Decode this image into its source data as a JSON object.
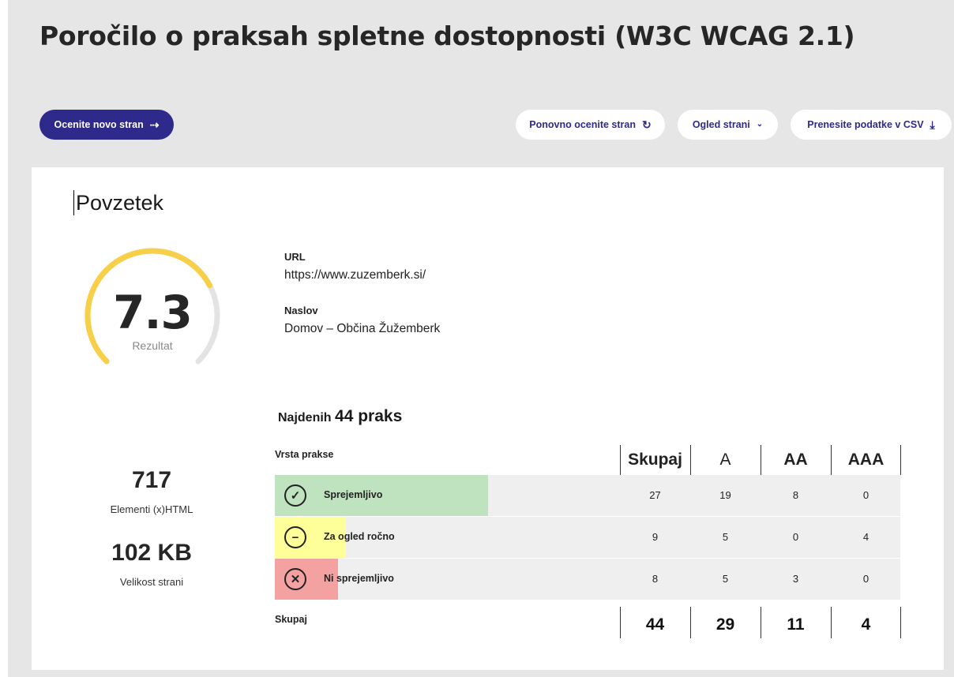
{
  "page": {
    "title": "Poročilo o praksah spletne dostopnosti (W3C WCAG 2.1)"
  },
  "toolbar": {
    "new_page_label": "Ocenite novo stran",
    "new_page_icon": "arrow-right-icon",
    "reassess_label": "Ponovno ocenite stran",
    "reassess_icon": "refresh-icon",
    "view_label": "Ogled strani",
    "view_icon": "chevron-down-icon",
    "csv_label": "Prenesite podatke v CSV",
    "csv_icon": "download-icon"
  },
  "summary": {
    "title": "Povzetek",
    "score": "7.3",
    "score_fraction": 0.73,
    "score_label": "Rezultat",
    "url_label": "URL",
    "url_value": "https://www.zuzemberk.si/",
    "title_label": "Naslov",
    "title_value": "Domov – Občina Žužemberk",
    "elements_count": "717",
    "elements_label": "Elementi (x)HTML",
    "page_size": "102 KB",
    "page_size_label": "Velikost strani"
  },
  "practices": {
    "found_prefix": "Najdenih",
    "found_count": "44 praks",
    "type_header": "Vrsta prakse",
    "columns": [
      "Skupaj",
      "A",
      "AA",
      "AAA"
    ],
    "rows": [
      {
        "label": "Sprejemljivo",
        "icon": "check-circle-icon",
        "color": "#bfe2bf",
        "fraction": 0.3409,
        "values": [
          "27",
          "19",
          "8",
          "0"
        ]
      },
      {
        "label": "Za ogled ročno",
        "icon": "minus-circle-icon",
        "color": "#ffff99",
        "fraction": 0.1136,
        "values": [
          "9",
          "5",
          "0",
          "4"
        ]
      },
      {
        "label": "Ni sprejemljivo",
        "icon": "x-circle-icon",
        "color": "#f4a1a1",
        "fraction": 0.1009,
        "values": [
          "8",
          "5",
          "3",
          "0"
        ]
      }
    ],
    "total_label": "Skupaj",
    "totals": [
      "44",
      "29",
      "11",
      "4"
    ]
  },
  "colors": {
    "primary": "#2e2a8c",
    "gauge_fill": "#f7cf48",
    "gauge_track": "#e3e3e3"
  }
}
